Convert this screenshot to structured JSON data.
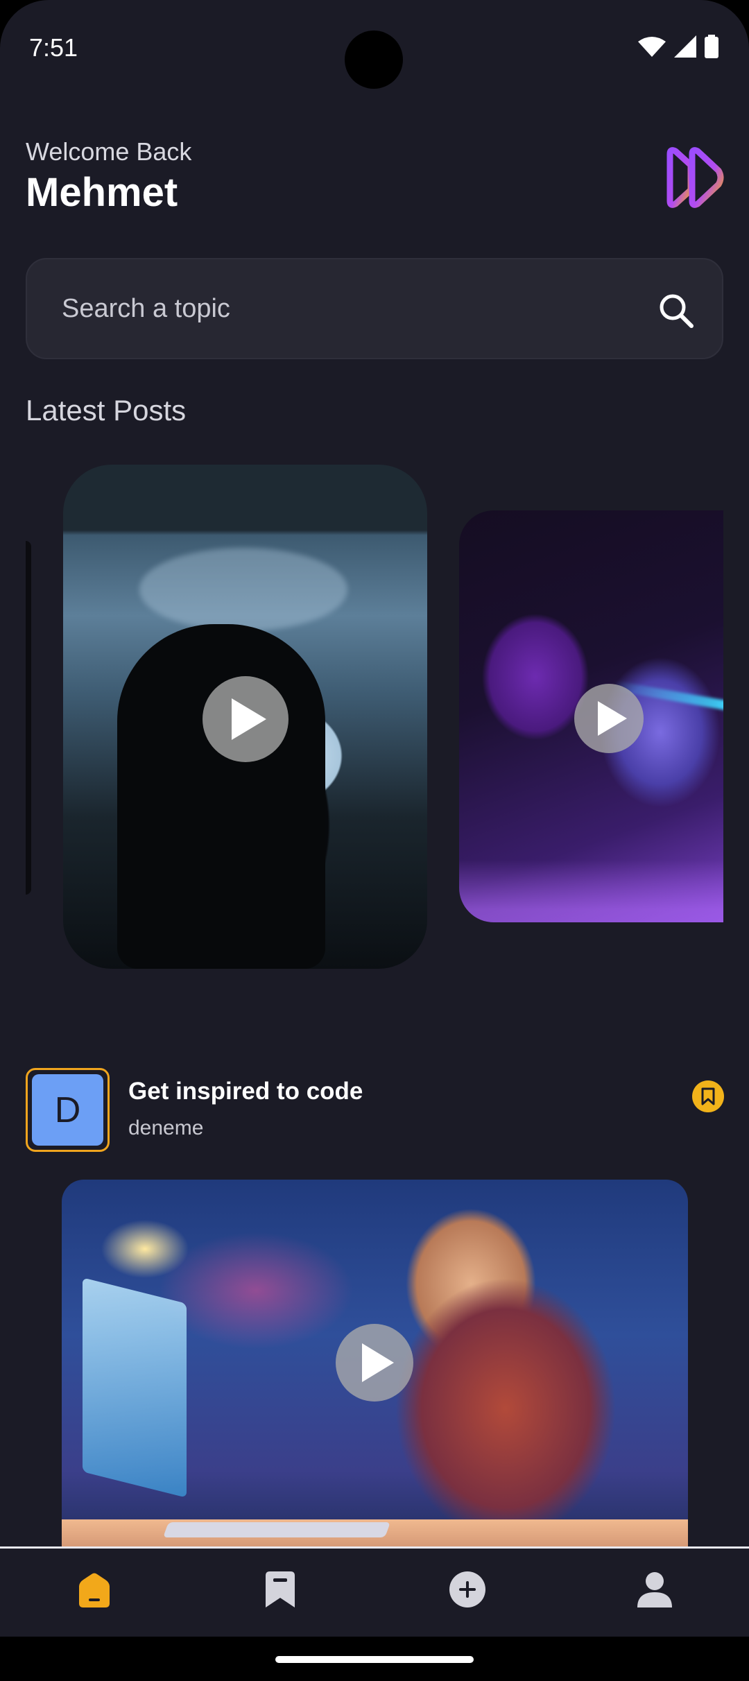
{
  "status_bar": {
    "time": "7:51"
  },
  "header": {
    "welcome": "Welcome Back",
    "username": "Mehmet"
  },
  "search": {
    "placeholder": "Search a topic"
  },
  "latest_posts": {
    "title": "Latest Posts",
    "cards": [
      {
        "name": "hooded-hacker-video"
      },
      {
        "name": "vr-robot-video"
      }
    ]
  },
  "post": {
    "avatar_initial": "D",
    "title": "Get inspired to code",
    "author": "deneme"
  },
  "nav": {
    "items": [
      {
        "icon": "home-icon",
        "active": true
      },
      {
        "icon": "bookmark-icon",
        "active": false
      },
      {
        "icon": "add-icon",
        "active": false
      },
      {
        "icon": "profile-icon",
        "active": false
      }
    ]
  },
  "colors": {
    "background": "#1b1b26",
    "accent": "#f2b31a",
    "avatar": "#6c9ff5",
    "search_bg": "#272732"
  }
}
